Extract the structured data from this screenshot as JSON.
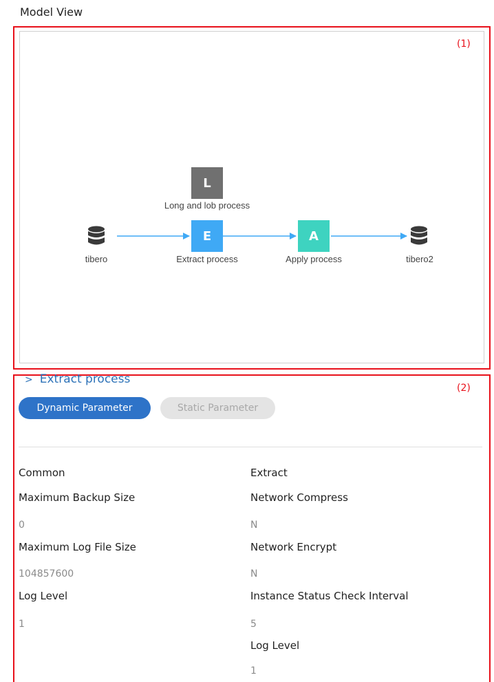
{
  "page_title": "Model View",
  "callouts": {
    "one": "(1)",
    "two": "(2)"
  },
  "model": {
    "source": {
      "label": "tibero",
      "icon": "database-icon"
    },
    "long_lob": {
      "letter": "L",
      "label": "Long and lob process",
      "color": "#707070"
    },
    "extract": {
      "letter": "E",
      "label": "Extract process",
      "color": "#3fa9f5"
    },
    "apply": {
      "letter": "A",
      "label": "Apply process",
      "color": "#3ed3c0"
    },
    "target": {
      "label": "tibero2",
      "icon": "database-icon"
    },
    "arrow_color": "#3fa9f5"
  },
  "detail": {
    "breadcrumb_chevron": ">",
    "breadcrumb": "Extract process",
    "tabs": {
      "dynamic": "Dynamic Parameter",
      "static": "Static Parameter"
    },
    "common": {
      "heading": "Common",
      "fields": [
        {
          "label": "Maximum Backup Size",
          "value": "0"
        },
        {
          "label": "Maximum Log File Size",
          "value": "104857600"
        },
        {
          "label": "Log Level",
          "value": "1"
        }
      ]
    },
    "extract": {
      "heading": "Extract",
      "fields": [
        {
          "label": "Network Compress",
          "value": "N"
        },
        {
          "label": "Network Encrypt",
          "value": "N"
        },
        {
          "label": "Instance Status Check Interval",
          "value": "5"
        },
        {
          "label": "Log Level",
          "value": "1"
        }
      ]
    }
  }
}
